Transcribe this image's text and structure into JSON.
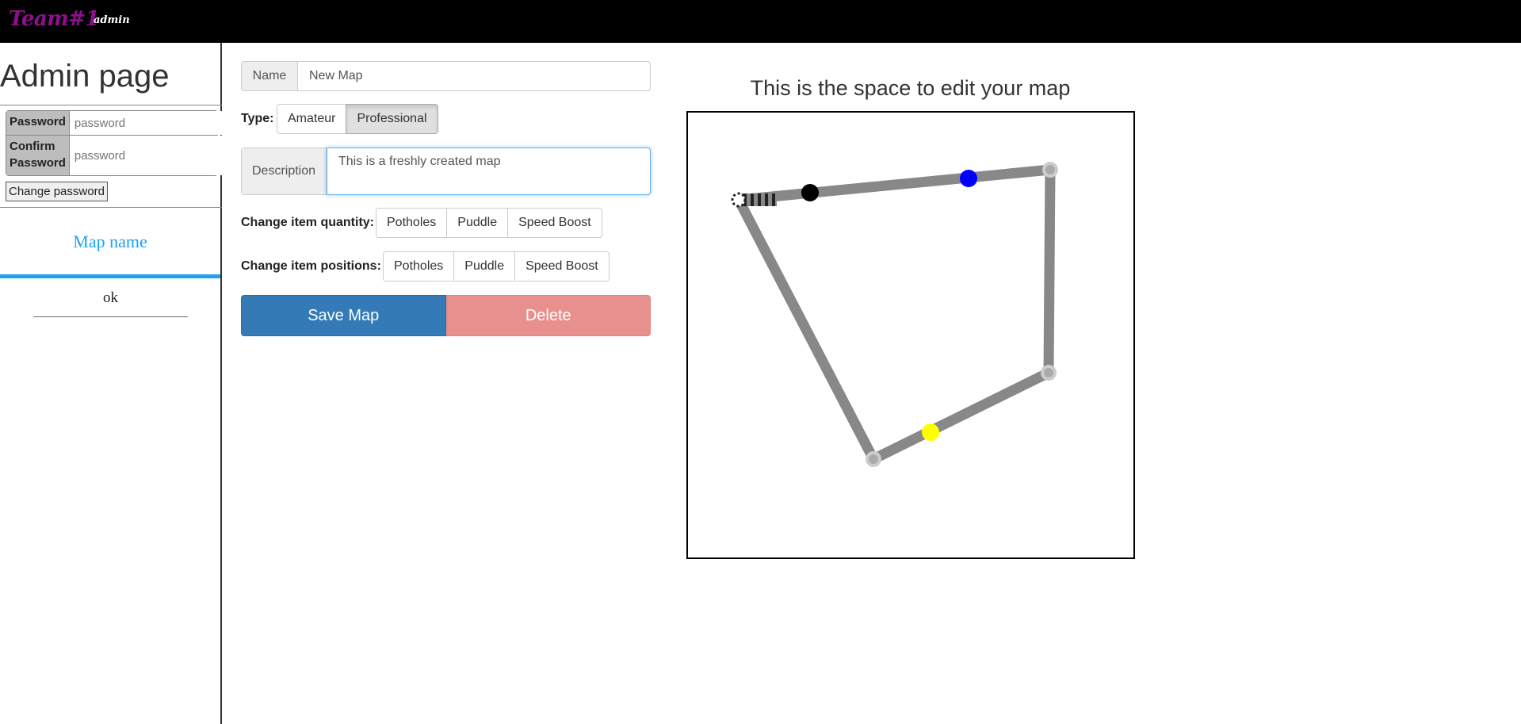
{
  "header": {
    "brand": "Team#1",
    "user": "admin"
  },
  "sidebar": {
    "title": "Admin page",
    "password_label": "Password",
    "password_placeholder": "password",
    "confirm_label_line1": "Confirm",
    "confirm_label_line2": "Password",
    "confirm_placeholder": "password",
    "change_password_button": "Change password",
    "maps": [
      {
        "name": "Map name",
        "selected": true
      },
      {
        "name": "ok",
        "selected": false
      }
    ]
  },
  "form": {
    "name_label": "Name",
    "name_value": "New Map",
    "type_label": "Type:",
    "type_options": [
      "Amateur",
      "Professional"
    ],
    "type_selected": "Professional",
    "description_label": "Description",
    "description_value": "This is a freshly created map",
    "quantity_label": "Change item quantity:",
    "quantity_buttons": [
      "Potholes",
      "Puddle",
      "Speed Boost"
    ],
    "positions_label": "Change item positions:",
    "positions_buttons": [
      "Potholes",
      "Puddle",
      "Speed Boost"
    ],
    "save_button": "Save Map",
    "delete_button": "Delete"
  },
  "editor": {
    "title": "This is the space to edit your map",
    "colors": {
      "track": "#888888",
      "node": "#cccccc",
      "item_black": "#000000",
      "item_blue": "#0000ff",
      "item_yellow": "#ffff00"
    }
  }
}
